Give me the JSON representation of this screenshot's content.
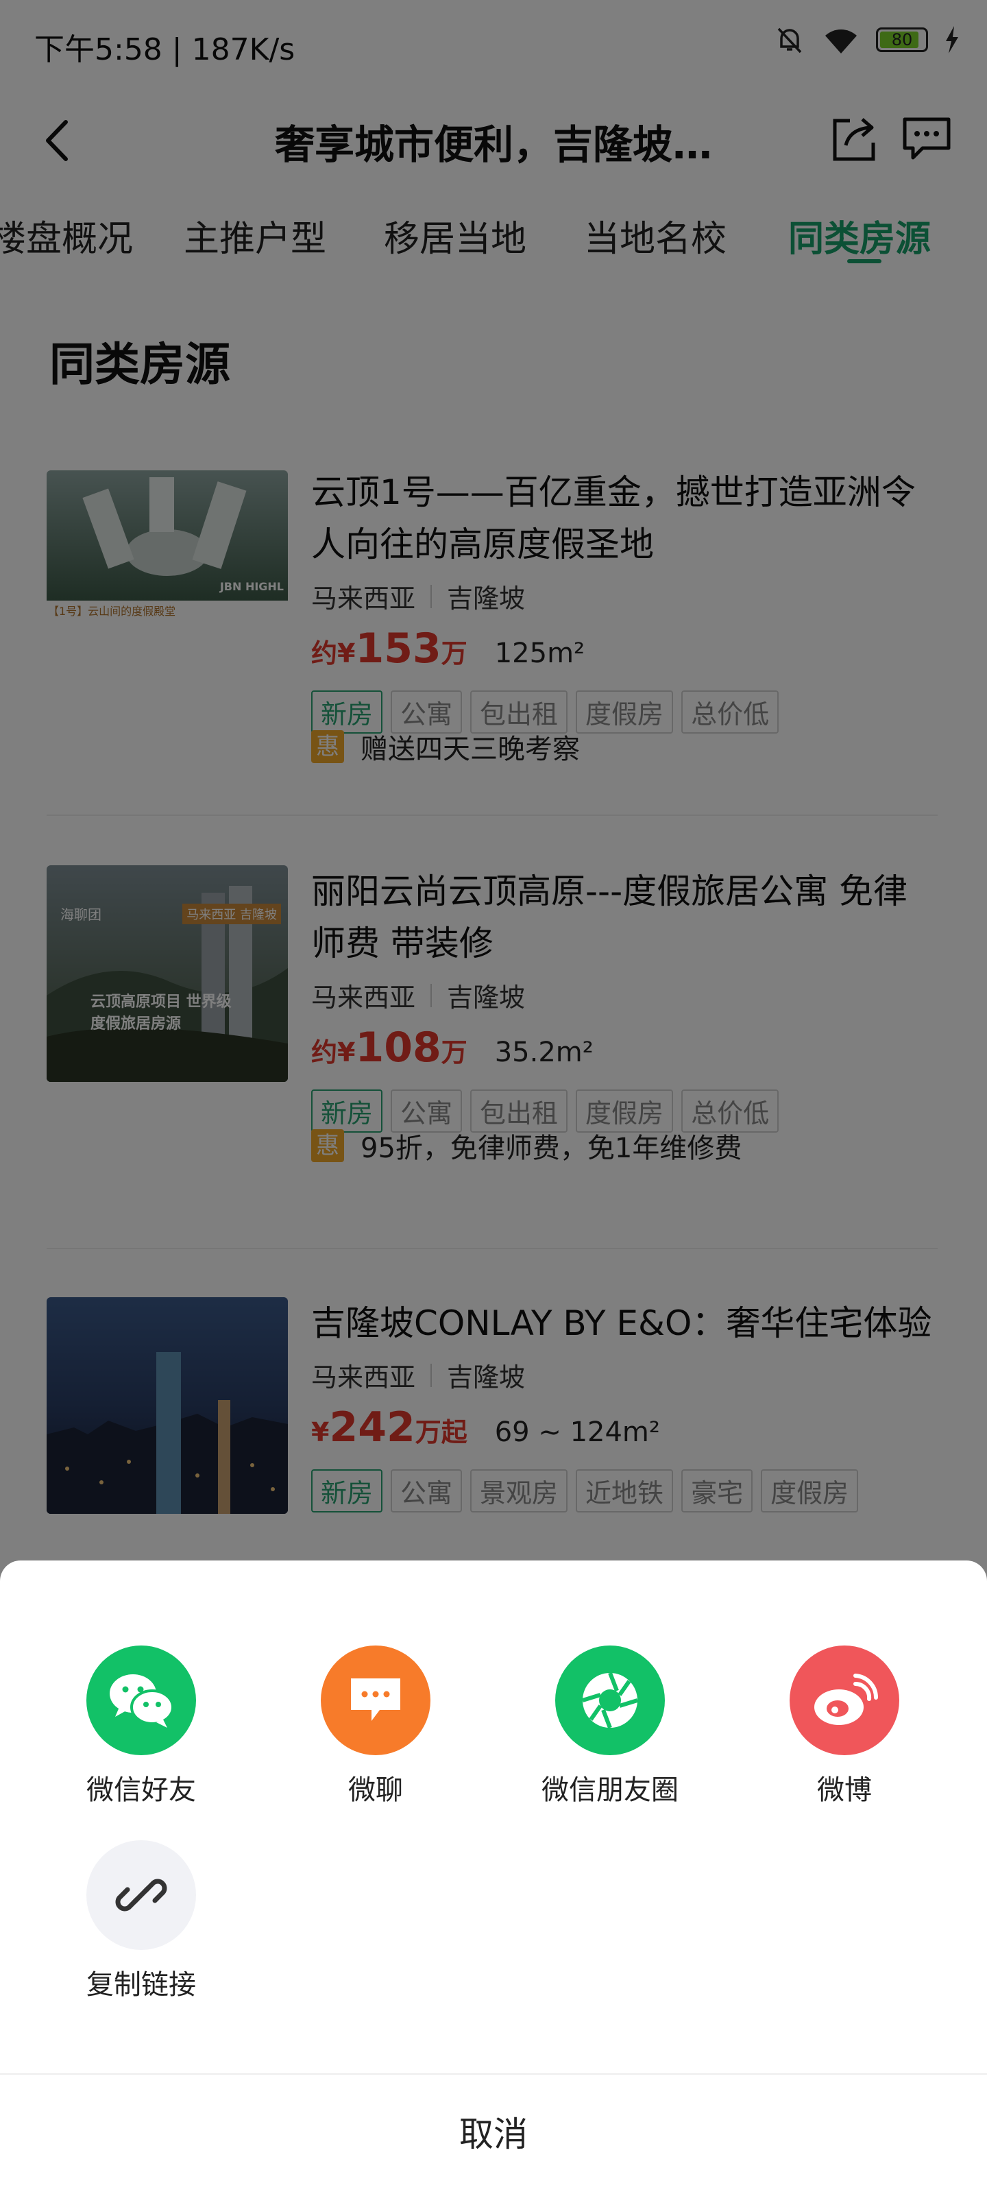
{
  "status_bar": {
    "time": "下午5:58 | 187K/s",
    "battery": "80"
  },
  "header": {
    "title": "奢享城市便利，吉隆坡…"
  },
  "tabs": [
    {
      "label": "楼盘概况"
    },
    {
      "label": "主推户型"
    },
    {
      "label": "移居当地"
    },
    {
      "label": "当地名校"
    },
    {
      "label": "同类房源",
      "active": true
    }
  ],
  "section": {
    "title": "同类房源"
  },
  "listings": [
    {
      "title": "云顶1号——百亿重金，撼世打造亚洲令人向往的高原度假圣地",
      "country": "马来西亚",
      "city": "吉隆坡",
      "price_prefix": "约¥",
      "price": "153",
      "price_unit": "万",
      "area": "125m²",
      "tags": [
        "新房",
        "公寓",
        "包出租",
        "度假房",
        "总价低"
      ],
      "promo_badge": "惠",
      "promo": "赠送四天三晚考察",
      "thumb_text": "【1号】云山间的度假殿堂",
      "thumb_brand": "JBN HIGHL"
    },
    {
      "title": "丽阳云尚云顶高原---度假旅居公寓 免律师费 带装修",
      "country": "马来西亚",
      "city": "吉隆坡",
      "price_prefix": "约¥",
      "price": "108",
      "price_unit": "万",
      "area": "35.2m²",
      "tags": [
        "新房",
        "公寓",
        "包出租",
        "度假房",
        "总价低"
      ],
      "promo_badge": "惠",
      "promo": "95折，免律师费，免1年维修费",
      "thumb_text": "云顶高原项目 世界级度假旅居房源",
      "thumb_brand": "海聊团",
      "thumb_badge": "马来西亚 吉隆坡"
    },
    {
      "title": "吉隆坡CONLAY BY E&O：奢华住宅体验",
      "country": "马来西亚",
      "city": "吉隆坡",
      "price_prefix": "¥",
      "price": "242",
      "price_unit": "万起",
      "area": "69 ~ 124m²",
      "tags": [
        "新房",
        "公寓",
        "景观房",
        "近地铁",
        "豪宅",
        "度假房"
      ]
    }
  ],
  "share_sheet": {
    "items": [
      {
        "label": "微信好友",
        "icon": "wechat-icon",
        "color": "#12c167"
      },
      {
        "label": "微聊",
        "icon": "chat-icon",
        "color": "#f77b2a"
      },
      {
        "label": "微信朋友圈",
        "icon": "moments-icon",
        "color": "#12c167"
      },
      {
        "label": "微博",
        "icon": "weibo-icon",
        "color": "#f0565a"
      },
      {
        "label": "复制链接",
        "icon": "link-icon",
        "color": "#f1f2f6"
      }
    ],
    "cancel": "取消"
  }
}
